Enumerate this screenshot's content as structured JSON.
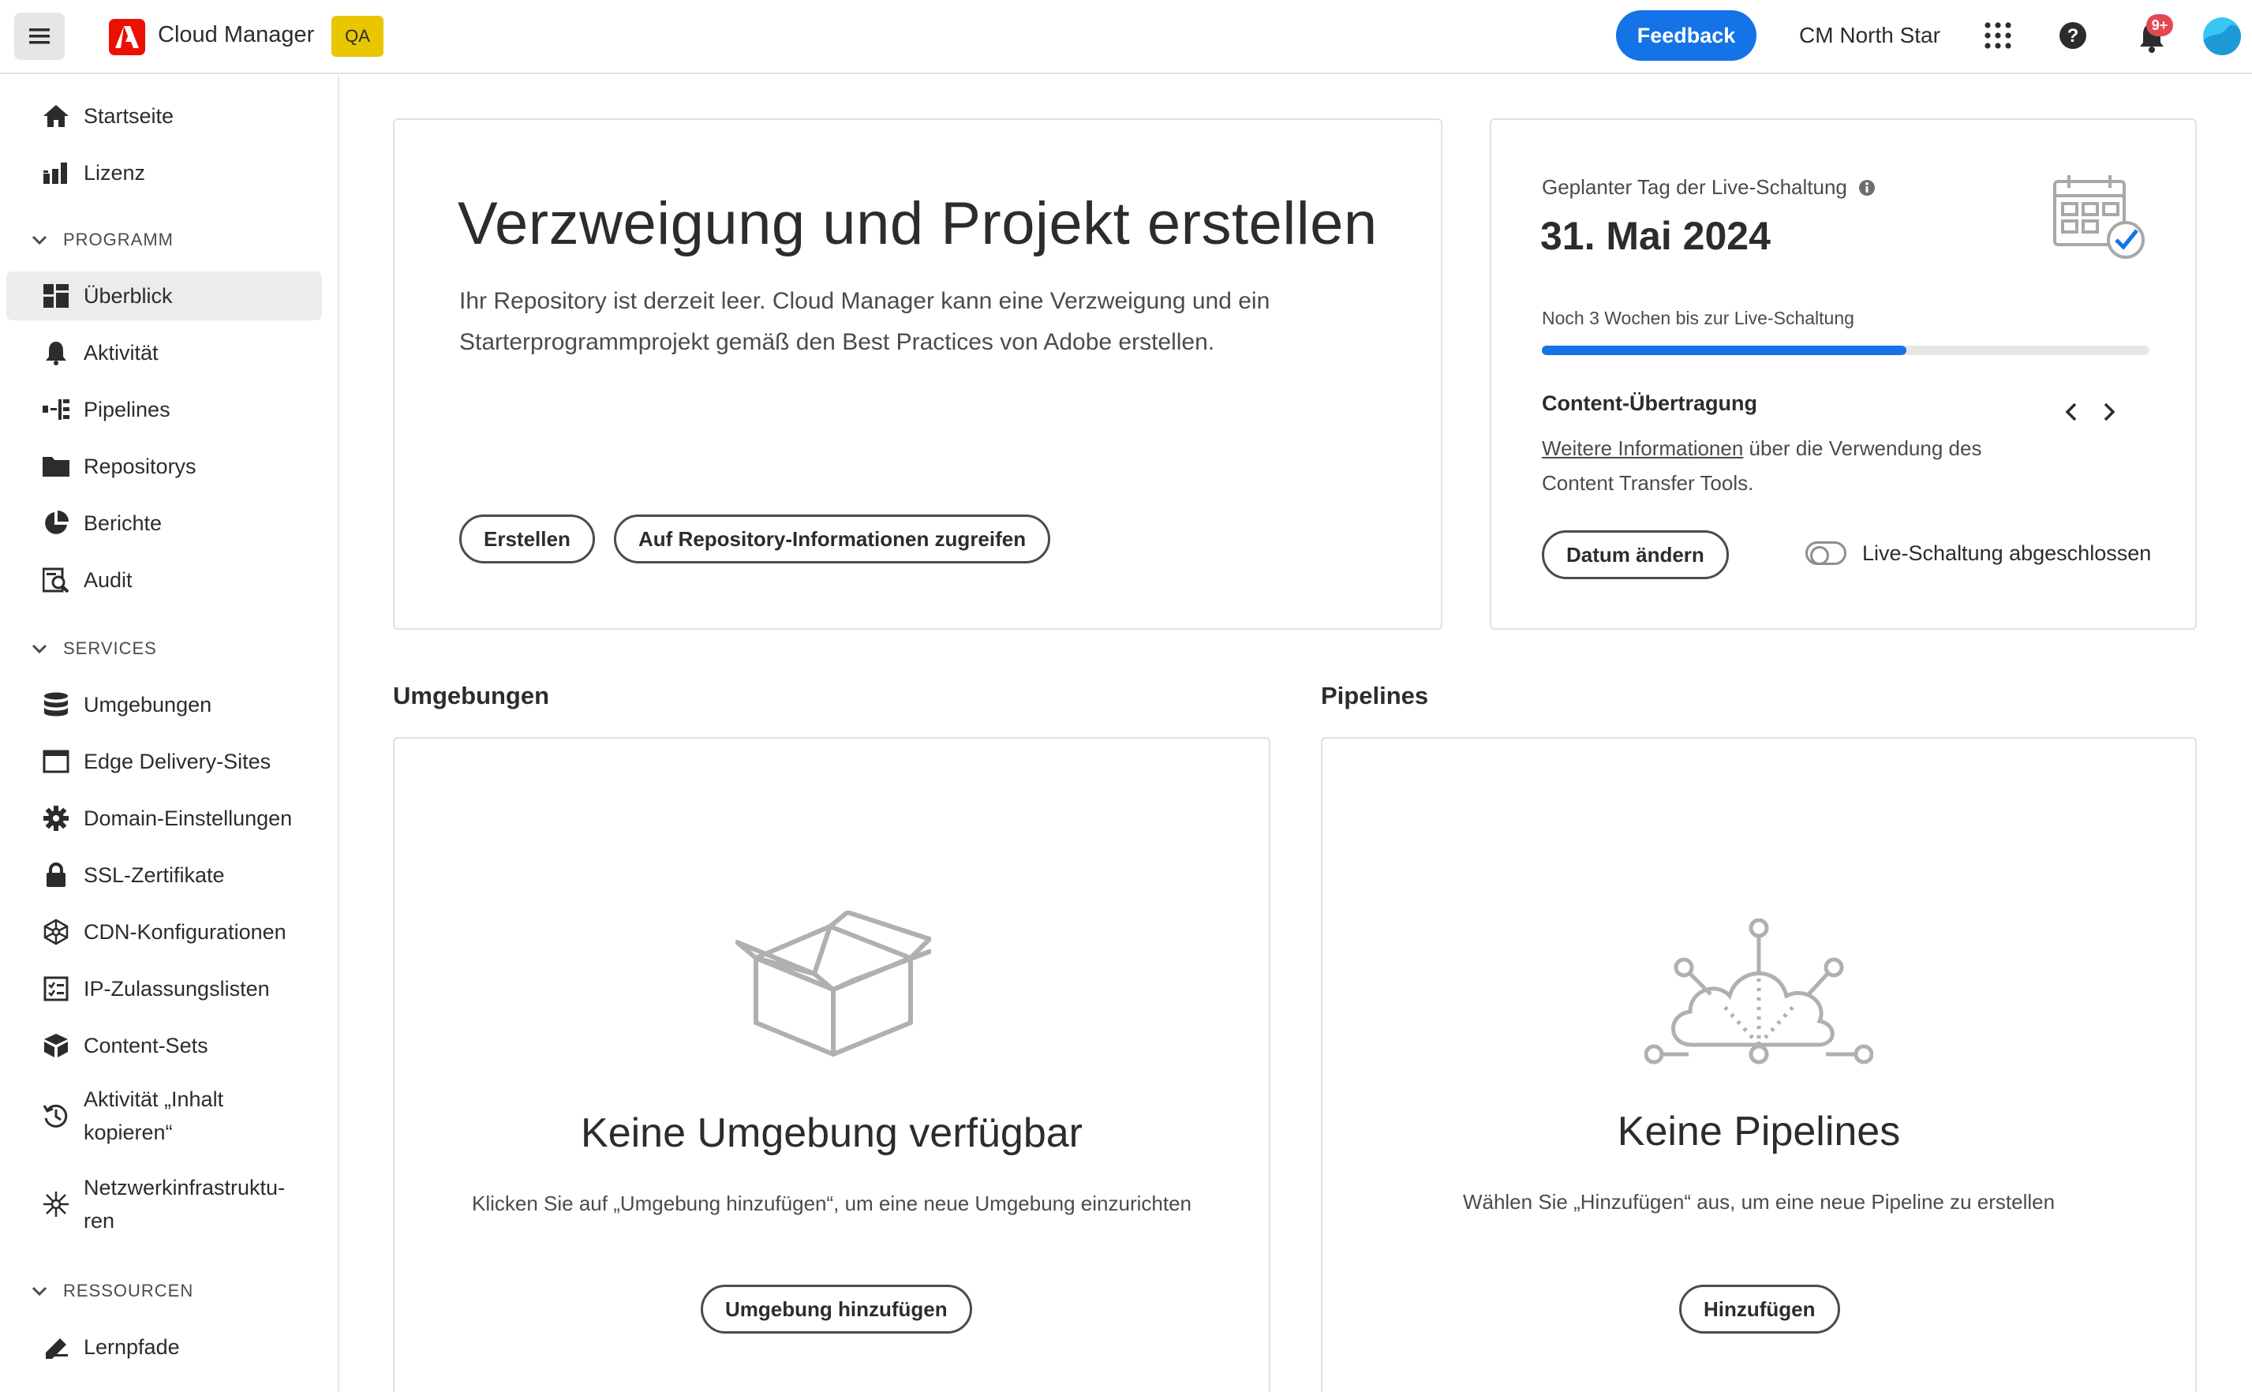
{
  "header": {
    "menu_icon": "hamburger-menu-icon",
    "logo_icon": "adobe-logo-icon",
    "app_name": "Cloud Manager",
    "env_badge": "QA",
    "feedback_label": "Feedback",
    "org_name": "CM North Star",
    "apps_icon": "app-switcher-grid-icon",
    "help_icon": "help-icon",
    "notifications_icon": "bell-icon",
    "notifications_count": "9+",
    "accent_color": "#1473e6",
    "brand_color": "#eb1000",
    "badge_color": "#e8c600"
  },
  "sidebar": {
    "top_items": [
      {
        "label": "Startseite",
        "icon": "home-icon"
      },
      {
        "label": "Lizenz",
        "icon": "license-icon"
      }
    ],
    "sections": [
      {
        "title": "PROGRAMM",
        "items": [
          {
            "label": "Überblick",
            "icon": "overview-grid-icon",
            "active": true
          },
          {
            "label": "Aktivität",
            "icon": "bell-icon"
          },
          {
            "label": "Pipelines",
            "icon": "pipeline-icon"
          },
          {
            "label": "Repositorys",
            "icon": "folder-icon"
          },
          {
            "label": "Berichte",
            "icon": "reports-pie-icon"
          },
          {
            "label": "Audit",
            "icon": "audit-icon"
          }
        ]
      },
      {
        "title": "SERVICES",
        "items": [
          {
            "label": "Umgebungen",
            "icon": "database-icon"
          },
          {
            "label": "Edge Delivery-Sites",
            "icon": "browser-window-icon"
          },
          {
            "label": "Domain-Einstellungen",
            "icon": "gear-icon"
          },
          {
            "label": "SSL-Zertifikate",
            "icon": "lock-icon"
          },
          {
            "label": "CDN-Konfigurationen",
            "icon": "network-hex-icon"
          },
          {
            "label": "IP-Zulassungslisten",
            "icon": "checklist-icon"
          },
          {
            "label": "Content-Sets",
            "icon": "boxes-icon"
          },
          {
            "label": "Aktivität „Inhalt kopieren“",
            "icon": "history-icon"
          },
          {
            "label": "Netzwerkinfrastruktu-ren",
            "icon": "network-star-icon"
          }
        ]
      },
      {
        "title": "RESSOURCEN",
        "items": [
          {
            "label": "Lernpfade",
            "icon": "learn-icon"
          }
        ]
      }
    ]
  },
  "hero": {
    "title": "Verzweigung und Projekt erstellen",
    "description": "Ihr Repository ist derzeit leer. Cloud Manager kann eine Verzweigung und ein Starterprogrammprojekt gemäß den Best Practices von Adobe erstellen.",
    "create_label": "Erstellen",
    "repo_info_label": "Auf Repository-Informationen zugreifen"
  },
  "golive": {
    "label": "Geplanter Tag der Live-Schaltung",
    "date": "31. Mai 2024",
    "remaining": "Noch 3 Wochen bis zur Live-Schaltung",
    "progress_fraction": 0.6,
    "content_transfer_title": "Content-Übertragung",
    "link_text": "Weitere Informationen",
    "desc_rest": " über die Verwendung des Content Transfer Tools.",
    "change_date_label": "Datum ändern",
    "toggle_label": "Live-Schaltung abgeschlossen",
    "toggle_on": false
  },
  "environments": {
    "section_title": "Umgebungen",
    "empty_title": "Keine Umgebung verfügbar",
    "empty_desc": "Klicken Sie auf „Umgebung hinzufügen“, um eine neue Umgebung einzurichten",
    "button_label": "Umgebung hinzufügen"
  },
  "pipelines": {
    "section_title": "Pipelines",
    "empty_title": "Keine Pipelines",
    "empty_desc": "Wählen Sie „Hinzufügen“ aus, um eine neue Pipeline zu erstellen",
    "button_label": "Hinzufügen"
  }
}
